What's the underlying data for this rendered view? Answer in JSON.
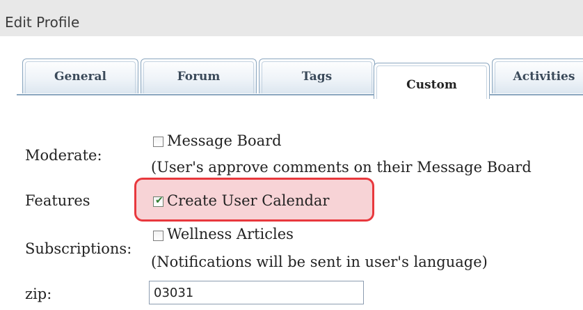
{
  "header": {
    "title": "Edit Profile"
  },
  "tabs": [
    {
      "label": "General"
    },
    {
      "label": "Forum"
    },
    {
      "label": "Tags"
    },
    {
      "label": "Custom",
      "active": true
    },
    {
      "label": "Activities"
    }
  ],
  "form": {
    "moderate": {
      "label": "Moderate:",
      "option": "Message Board",
      "checked": false,
      "note": "(User's approve comments on their Message Board"
    },
    "features": {
      "label": "Features",
      "option": "Create User Calendar",
      "checked": true
    },
    "subscriptions": {
      "label": "Subscriptions:",
      "option": "Wellness Articles",
      "checked": false,
      "note": "(Notifications will be sent in user's language)"
    },
    "zip": {
      "label": "zip:",
      "value": "03031"
    }
  },
  "colors": {
    "highlight_border": "#e8383d",
    "highlight_fill": "#f7d3d6",
    "tab_border": "#8aa6bf"
  }
}
